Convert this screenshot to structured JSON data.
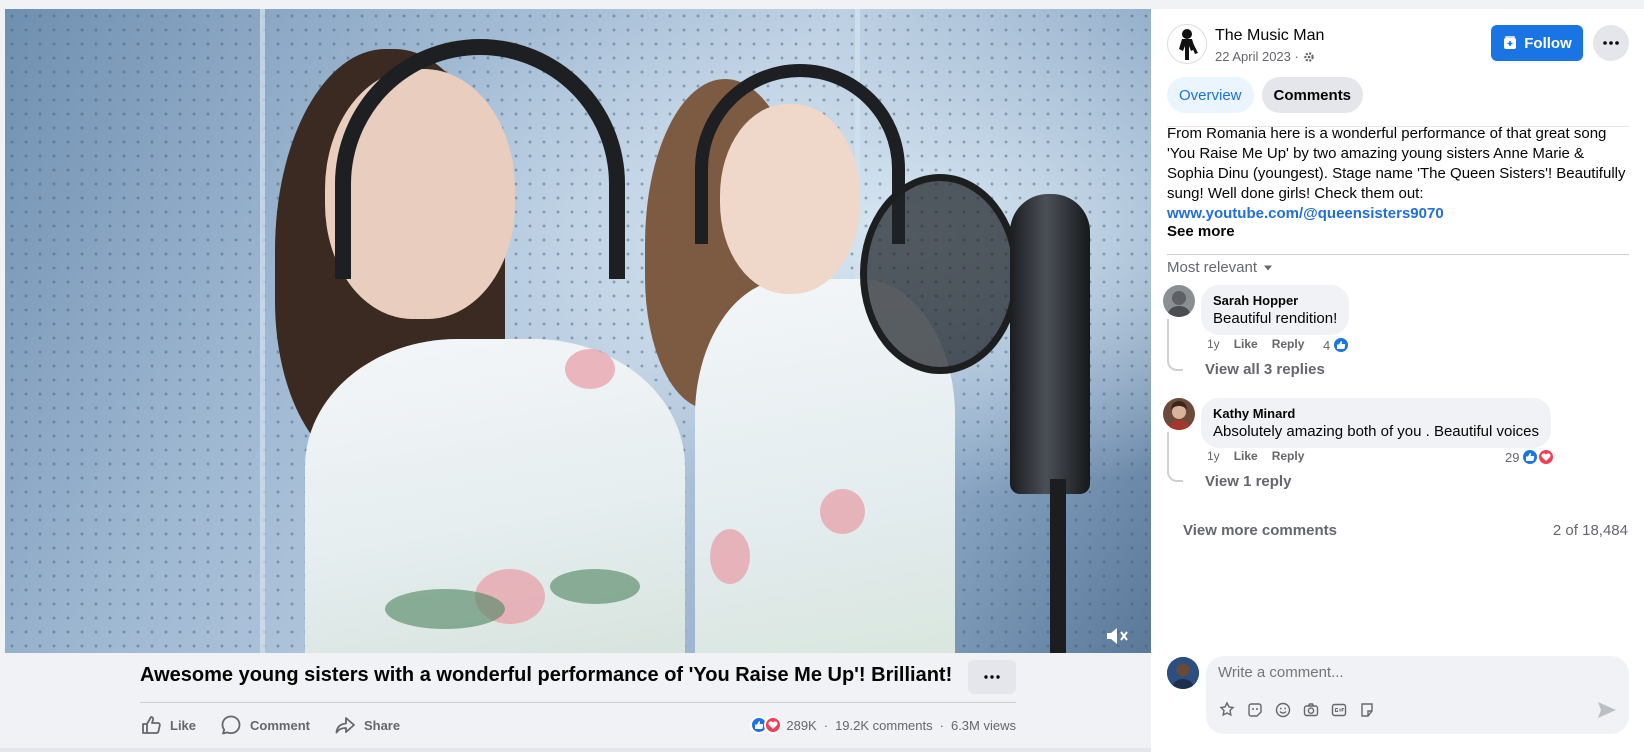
{
  "video": {
    "title": "Awesome young sisters with a wonderful performance of 'You Raise Me Up'! Brilliant!",
    "muted": true
  },
  "actions": {
    "like_label": "Like",
    "comment_label": "Comment",
    "share_label": "Share"
  },
  "stats": {
    "reactions": "289K",
    "comments": "19.2K comments",
    "views": "6.3M views",
    "sep1": "·",
    "sep2": "·"
  },
  "post": {
    "page_name": "The Music Man",
    "date": "22 April 2023 ·",
    "follow_label": "Follow",
    "tabs": [
      {
        "label": "Overview",
        "active": true
      },
      {
        "label": "Comments",
        "active": false
      }
    ],
    "description": "From Romania here is a wonderful performance of that great song 'You Raise Me Up' by two amazing young sisters Anne Marie & Sophia Dinu (youngest). Stage name 'The Queen Sisters'! Beautifully sung! Well done girls! Check them out:",
    "link": "www.youtube.com/@queensisters9070",
    "see_more": "See more"
  },
  "comments": {
    "sort_label": "Most relevant",
    "items": [
      {
        "author": "Sarah Hopper",
        "text": "Beautiful rendition!",
        "age": "1y",
        "like_label": "Like",
        "reply_label": "Reply",
        "reaction_count": "4",
        "replies_label": "View all 3 replies"
      },
      {
        "author": "Kathy Minard",
        "text": "Absolutely amazing both of you . Beautiful voices",
        "age": "1y",
        "like_label": "Like",
        "reply_label": "Reply",
        "reaction_count": "29",
        "replies_label": "View 1 reply"
      }
    ],
    "view_more_label": "View more comments",
    "count_label": "2 of 18,484",
    "composer_placeholder": "Write a comment..."
  },
  "colors": {
    "accent": "#1b74e4",
    "love": "#f33e58",
    "panel_bg": "#ffffff",
    "muted_text": "#65676b"
  },
  "icons": [
    "mute-icon",
    "ellipsis-icon",
    "like-icon",
    "comment-icon",
    "share-icon",
    "settings-icon",
    "follow-icon",
    "chevron-down-icon",
    "sticker-icon",
    "avatar-sticker-icon",
    "emoji-icon",
    "camera-icon",
    "gif-icon",
    "sticker-pack-icon",
    "send-icon"
  ]
}
